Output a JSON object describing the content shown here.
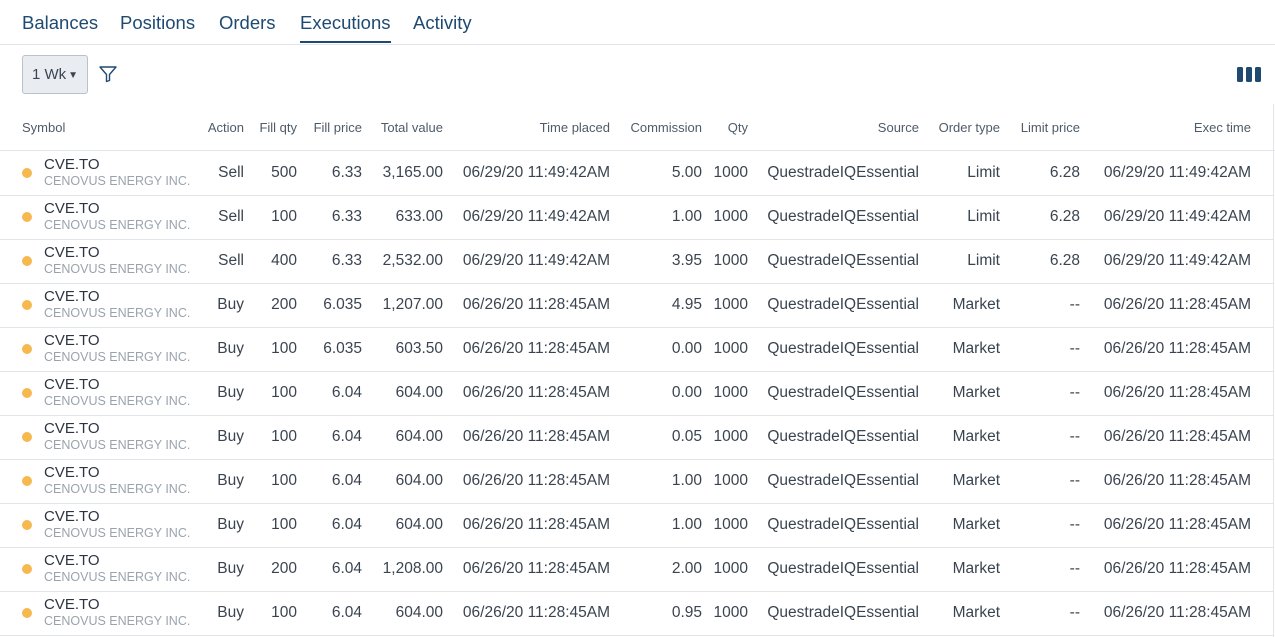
{
  "tabs": [
    {
      "label": "Balances",
      "active": false
    },
    {
      "label": "Positions",
      "active": false
    },
    {
      "label": "Orders",
      "active": false
    },
    {
      "label": "Executions",
      "active": true
    },
    {
      "label": "Activity",
      "active": false
    }
  ],
  "toolbar": {
    "period_value": "1 Wk",
    "filter_icon": "filter-icon",
    "columns_icon": "columns-icon"
  },
  "colors": {
    "accent": "#1e4a72",
    "dot": "#f6b950",
    "border": "#e1e4e8"
  },
  "table": {
    "headers": [
      "Symbol",
      "Action",
      "Fill qty",
      "Fill price",
      "Total value",
      "Time placed",
      "Commission",
      "Qty",
      "Source",
      "Order type",
      "Limit price",
      "Exec time"
    ],
    "rows": [
      {
        "symbol": "CVE.TO",
        "company": "CENOVUS ENERGY INC.",
        "action": "Sell",
        "fill_qty": "500",
        "fill_price": "6.33",
        "total_value": "3,165.00",
        "time_placed": "06/29/20 11:49:42AM",
        "commission": "5.00",
        "qty": "1000",
        "source": "QuestradeIQEssential",
        "order_type": "Limit",
        "limit_price": "6.28",
        "exec_time": "06/29/20 11:49:42AM"
      },
      {
        "symbol": "CVE.TO",
        "company": "CENOVUS ENERGY INC.",
        "action": "Sell",
        "fill_qty": "100",
        "fill_price": "6.33",
        "total_value": "633.00",
        "time_placed": "06/29/20 11:49:42AM",
        "commission": "1.00",
        "qty": "1000",
        "source": "QuestradeIQEssential",
        "order_type": "Limit",
        "limit_price": "6.28",
        "exec_time": "06/29/20 11:49:42AM"
      },
      {
        "symbol": "CVE.TO",
        "company": "CENOVUS ENERGY INC.",
        "action": "Sell",
        "fill_qty": "400",
        "fill_price": "6.33",
        "total_value": "2,532.00",
        "time_placed": "06/29/20 11:49:42AM",
        "commission": "3.95",
        "qty": "1000",
        "source": "QuestradeIQEssential",
        "order_type": "Limit",
        "limit_price": "6.28",
        "exec_time": "06/29/20 11:49:42AM"
      },
      {
        "symbol": "CVE.TO",
        "company": "CENOVUS ENERGY INC.",
        "action": "Buy",
        "fill_qty": "200",
        "fill_price": "6.035",
        "total_value": "1,207.00",
        "time_placed": "06/26/20 11:28:45AM",
        "commission": "4.95",
        "qty": "1000",
        "source": "QuestradeIQEssential",
        "order_type": "Market",
        "limit_price": "--",
        "exec_time": "06/26/20 11:28:45AM"
      },
      {
        "symbol": "CVE.TO",
        "company": "CENOVUS ENERGY INC.",
        "action": "Buy",
        "fill_qty": "100",
        "fill_price": "6.035",
        "total_value": "603.50",
        "time_placed": "06/26/20 11:28:45AM",
        "commission": "0.00",
        "qty": "1000",
        "source": "QuestradeIQEssential",
        "order_type": "Market",
        "limit_price": "--",
        "exec_time": "06/26/20 11:28:45AM"
      },
      {
        "symbol": "CVE.TO",
        "company": "CENOVUS ENERGY INC.",
        "action": "Buy",
        "fill_qty": "100",
        "fill_price": "6.04",
        "total_value": "604.00",
        "time_placed": "06/26/20 11:28:45AM",
        "commission": "0.00",
        "qty": "1000",
        "source": "QuestradeIQEssential",
        "order_type": "Market",
        "limit_price": "--",
        "exec_time": "06/26/20 11:28:45AM"
      },
      {
        "symbol": "CVE.TO",
        "company": "CENOVUS ENERGY INC.",
        "action": "Buy",
        "fill_qty": "100",
        "fill_price": "6.04",
        "total_value": "604.00",
        "time_placed": "06/26/20 11:28:45AM",
        "commission": "0.05",
        "qty": "1000",
        "source": "QuestradeIQEssential",
        "order_type": "Market",
        "limit_price": "--",
        "exec_time": "06/26/20 11:28:45AM"
      },
      {
        "symbol": "CVE.TO",
        "company": "CENOVUS ENERGY INC.",
        "action": "Buy",
        "fill_qty": "100",
        "fill_price": "6.04",
        "total_value": "604.00",
        "time_placed": "06/26/20 11:28:45AM",
        "commission": "1.00",
        "qty": "1000",
        "source": "QuestradeIQEssential",
        "order_type": "Market",
        "limit_price": "--",
        "exec_time": "06/26/20 11:28:45AM"
      },
      {
        "symbol": "CVE.TO",
        "company": "CENOVUS ENERGY INC.",
        "action": "Buy",
        "fill_qty": "100",
        "fill_price": "6.04",
        "total_value": "604.00",
        "time_placed": "06/26/20 11:28:45AM",
        "commission": "1.00",
        "qty": "1000",
        "source": "QuestradeIQEssential",
        "order_type": "Market",
        "limit_price": "--",
        "exec_time": "06/26/20 11:28:45AM"
      },
      {
        "symbol": "CVE.TO",
        "company": "CENOVUS ENERGY INC.",
        "action": "Buy",
        "fill_qty": "200",
        "fill_price": "6.04",
        "total_value": "1,208.00",
        "time_placed": "06/26/20 11:28:45AM",
        "commission": "2.00",
        "qty": "1000",
        "source": "QuestradeIQEssential",
        "order_type": "Market",
        "limit_price": "--",
        "exec_time": "06/26/20 11:28:45AM"
      },
      {
        "symbol": "CVE.TO",
        "company": "CENOVUS ENERGY INC.",
        "action": "Buy",
        "fill_qty": "100",
        "fill_price": "6.04",
        "total_value": "604.00",
        "time_placed": "06/26/20 11:28:45AM",
        "commission": "0.95",
        "qty": "1000",
        "source": "QuestradeIQEssential",
        "order_type": "Market",
        "limit_price": "--",
        "exec_time": "06/26/20 11:28:45AM"
      }
    ]
  }
}
